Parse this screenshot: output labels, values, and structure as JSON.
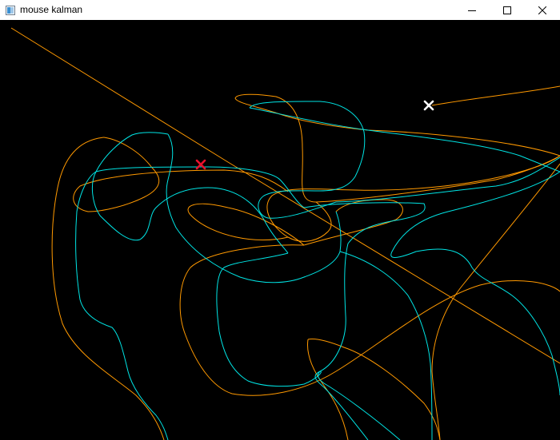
{
  "window": {
    "title": "mouse kalman",
    "icon": "opencv-window-icon",
    "controls": {
      "minimize_icon": "minimize-icon",
      "maximize_icon": "maximize-icon",
      "close_icon": "close-icon"
    }
  },
  "canvas": {
    "background_color": "#000000",
    "measured_track_color": "#00e5e5",
    "predicted_track_color": "#ff9900",
    "measured_marker_color": "#ffffff",
    "predicted_marker_color": "#e8112d",
    "measured_marker_icon": "x-mark-icon",
    "predicted_marker_icon": "x-mark-icon"
  }
}
